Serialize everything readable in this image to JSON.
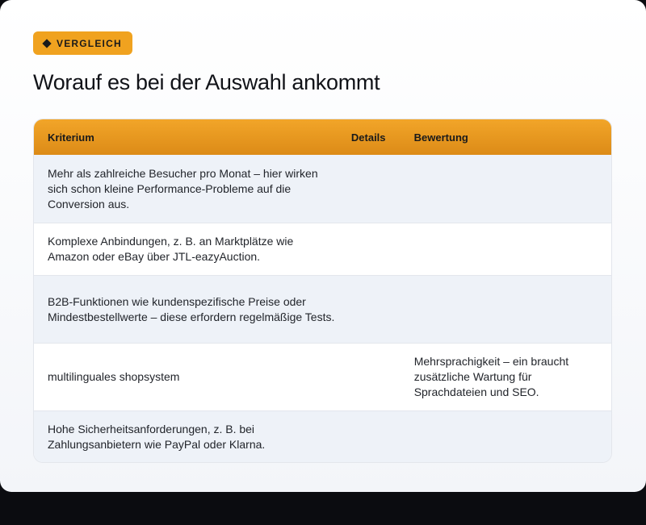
{
  "badge": {
    "icon": "diamond-icon",
    "label": "VERGLEICH",
    "color": "#f0a21f"
  },
  "title": "Worauf es bei der Auswahl ankommt",
  "table": {
    "headers": [
      "Kriterium",
      "Details",
      "Bewertung"
    ],
    "header_color": "#e89a22",
    "rows": [
      {
        "kriterium": "Mehr als zahlreiche Besucher pro Monat – hier wirken sich schon kleine Performance-Probleme auf die Conversion aus.",
        "details": "",
        "bewertung": ""
      },
      {
        "kriterium": "Komplexe Anbindungen, z. B. an Marktplätze wie Amazon oder eBay über JTL-eazyAuction.",
        "details": "",
        "bewertung": ""
      },
      {
        "kriterium": "B2B-Funktionen wie kundenspezifische Preise oder Mindestbestellwerte – diese erfordern regelmäßige Tests.",
        "details": "",
        "bewertung": ""
      },
      {
        "kriterium": "multilinguales shopsystem",
        "details": "",
        "bewertung": "Mehrsprachigkeit – ein braucht zusätzliche Wartung für Sprachdateien und SEO."
      },
      {
        "kriterium": "Hohe Sicherheitsanforderungen, z. B. bei Zahlungsanbietern wie PayPal oder Klarna.",
        "details": "",
        "bewertung": ""
      }
    ]
  }
}
